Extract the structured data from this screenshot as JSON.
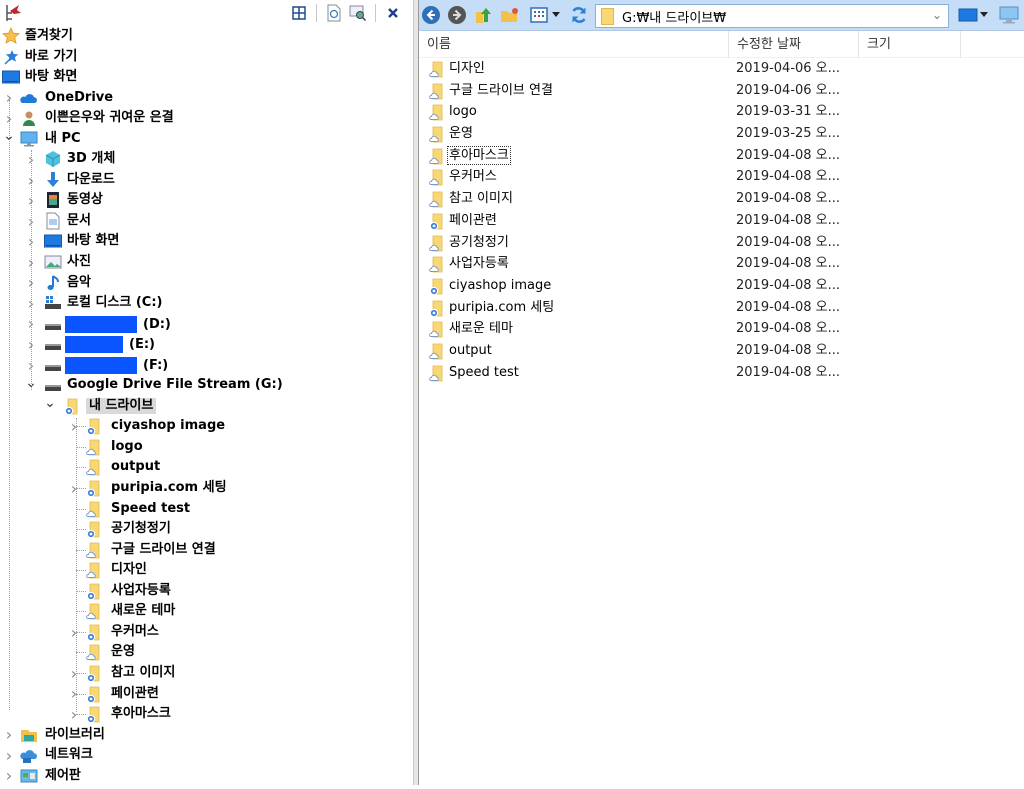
{
  "left_panel": {
    "toolbar": {
      "logo_icon": "app-logo-icon",
      "buttons": [
        {
          "name": "layout-grid-icon"
        },
        {
          "name": "refresh-page-icon"
        },
        {
          "name": "search-window-icon"
        },
        {
          "name": "close-icon"
        }
      ]
    },
    "tree": [
      {
        "label": "즐겨찾기",
        "icon": "star",
        "level": 0,
        "expander": "none"
      },
      {
        "label": "바로 가기",
        "icon": "pin-star",
        "level": 0,
        "expander": "none"
      },
      {
        "label": "바탕 화면",
        "icon": "desktop",
        "level": 0,
        "expander": "none"
      },
      {
        "label": "OneDrive",
        "icon": "cloud",
        "level": 1,
        "expander": "collapsed"
      },
      {
        "label": "이쁜은우와 귀여운 은결",
        "icon": "user",
        "level": 1,
        "expander": "collapsed"
      },
      {
        "label": "내 PC",
        "icon": "pc",
        "level": 1,
        "expander": "expanded"
      },
      {
        "label": "3D 개체",
        "icon": "cube",
        "level": 2,
        "expander": "collapsed"
      },
      {
        "label": "다운로드",
        "icon": "download",
        "level": 2,
        "expander": "collapsed"
      },
      {
        "label": "동영상",
        "icon": "video",
        "level": 2,
        "expander": "collapsed"
      },
      {
        "label": "문서",
        "icon": "document",
        "level": 2,
        "expander": "collapsed"
      },
      {
        "label": "바탕 화면",
        "icon": "desktop",
        "level": 2,
        "expander": "collapsed"
      },
      {
        "label": "사진",
        "icon": "picture",
        "level": 2,
        "expander": "collapsed"
      },
      {
        "label": "음악",
        "icon": "music",
        "level": 2,
        "expander": "collapsed"
      },
      {
        "label": "로컬 디스크 (C:)",
        "icon": "drive-win",
        "level": 2,
        "expander": "collapsed"
      },
      {
        "label": "(D:)",
        "icon": "drive",
        "level": 2,
        "expander": "collapsed",
        "redacted": "d"
      },
      {
        "label": "(E:)",
        "icon": "drive",
        "level": 2,
        "expander": "collapsed",
        "redacted": "e"
      },
      {
        "label": "(F:)",
        "icon": "drive",
        "level": 2,
        "expander": "collapsed",
        "redacted": "f"
      },
      {
        "label": "Google Drive File Stream (G:)",
        "icon": "drive",
        "level": 2,
        "expander": "expanded"
      },
      {
        "label": "내 드라이브",
        "icon": "folder-sync",
        "level": 3,
        "expander": "expanded",
        "selected": true
      },
      {
        "label": "ciyashop image",
        "icon": "folder-sync",
        "level": 4,
        "expander": "collapsed"
      },
      {
        "label": "logo",
        "icon": "folder-cloud",
        "level": 4,
        "expander": "none"
      },
      {
        "label": "output",
        "icon": "folder-cloud",
        "level": 4,
        "expander": "none"
      },
      {
        "label": "puripia.com 세팅",
        "icon": "folder-sync",
        "level": 4,
        "expander": "collapsed"
      },
      {
        "label": "Speed test",
        "icon": "folder-cloud",
        "level": 4,
        "expander": "none"
      },
      {
        "label": "공기청정기",
        "icon": "folder-sync",
        "level": 4,
        "expander": "none"
      },
      {
        "label": "구글 드라이브 연결",
        "icon": "folder-cloud",
        "level": 4,
        "expander": "none"
      },
      {
        "label": "디자인",
        "icon": "folder-cloud",
        "level": 4,
        "expander": "none"
      },
      {
        "label": "사업자등록",
        "icon": "folder-sync",
        "level": 4,
        "expander": "none"
      },
      {
        "label": "새로운 테마",
        "icon": "folder-cloud",
        "level": 4,
        "expander": "none"
      },
      {
        "label": "우커머스",
        "icon": "folder-sync",
        "level": 4,
        "expander": "collapsed"
      },
      {
        "label": "운영",
        "icon": "folder-cloud",
        "level": 4,
        "expander": "none"
      },
      {
        "label": "참고 이미지",
        "icon": "folder-sync",
        "level": 4,
        "expander": "collapsed"
      },
      {
        "label": "페이관련",
        "icon": "folder-sync",
        "level": 4,
        "expander": "collapsed"
      },
      {
        "label": "후아마스크",
        "icon": "folder-sync",
        "level": 4,
        "expander": "collapsed"
      },
      {
        "label": "라이브러리",
        "icon": "library",
        "level": 1,
        "expander": "collapsed"
      },
      {
        "label": "네트워크",
        "icon": "network",
        "level": 1,
        "expander": "collapsed"
      },
      {
        "label": "제어판",
        "icon": "control-panel",
        "level": 1,
        "expander": "collapsed"
      }
    ]
  },
  "right_panel": {
    "toolbar": {
      "buttons": [
        {
          "name": "back-icon"
        },
        {
          "name": "forward-icon"
        },
        {
          "name": "up-folder-icon"
        },
        {
          "name": "new-folder-icon"
        },
        {
          "name": "view-mode-icon"
        },
        {
          "name": "view-dropdown-icon"
        },
        {
          "name": "refresh-icon"
        }
      ],
      "address": "G:₩내 드라이브₩",
      "right_buttons": [
        {
          "name": "display-mode-icon"
        },
        {
          "name": "display-dropdown-icon"
        },
        {
          "name": "monitor-icon"
        }
      ]
    },
    "columns": {
      "name": "이름",
      "modified": "수정한 날짜",
      "size": "크기"
    },
    "files": [
      {
        "name": "디자인",
        "date": "2019-04-06 오...",
        "icon": "folder-cloud"
      },
      {
        "name": "구글 드라이브 연결",
        "date": "2019-04-06 오...",
        "icon": "folder-cloud"
      },
      {
        "name": "logo",
        "date": "2019-03-31 오...",
        "icon": "folder-cloud"
      },
      {
        "name": "운영",
        "date": "2019-03-25 오...",
        "icon": "folder-cloud"
      },
      {
        "name": "후아마스크",
        "date": "2019-04-08 오...",
        "icon": "folder-cloud",
        "focused": true
      },
      {
        "name": "우커머스",
        "date": "2019-04-08 오...",
        "icon": "folder-cloud"
      },
      {
        "name": "참고 이미지",
        "date": "2019-04-08 오...",
        "icon": "folder-cloud"
      },
      {
        "name": "페이관련",
        "date": "2019-04-08 오...",
        "icon": "folder-sync"
      },
      {
        "name": "공기청정기",
        "date": "2019-04-08 오...",
        "icon": "folder-cloud"
      },
      {
        "name": "사업자등록",
        "date": "2019-04-08 오...",
        "icon": "folder-cloud"
      },
      {
        "name": "ciyashop image",
        "date": "2019-04-08 오...",
        "icon": "folder-sync"
      },
      {
        "name": "puripia.com 세팅",
        "date": "2019-04-08 오...",
        "icon": "folder-sync"
      },
      {
        "name": "새로운 테마",
        "date": "2019-04-08 오...",
        "icon": "folder-cloud"
      },
      {
        "name": "output",
        "date": "2019-04-08 오...",
        "icon": "folder-cloud"
      },
      {
        "name": "Speed test",
        "date": "2019-04-08 오...",
        "icon": "folder-cloud"
      }
    ]
  },
  "colors": {
    "toolbar_bg": "#c5ddf7",
    "selection_bg": "#d9d9d9",
    "redaction": "#0a55ff",
    "folder": "#f8d775"
  }
}
